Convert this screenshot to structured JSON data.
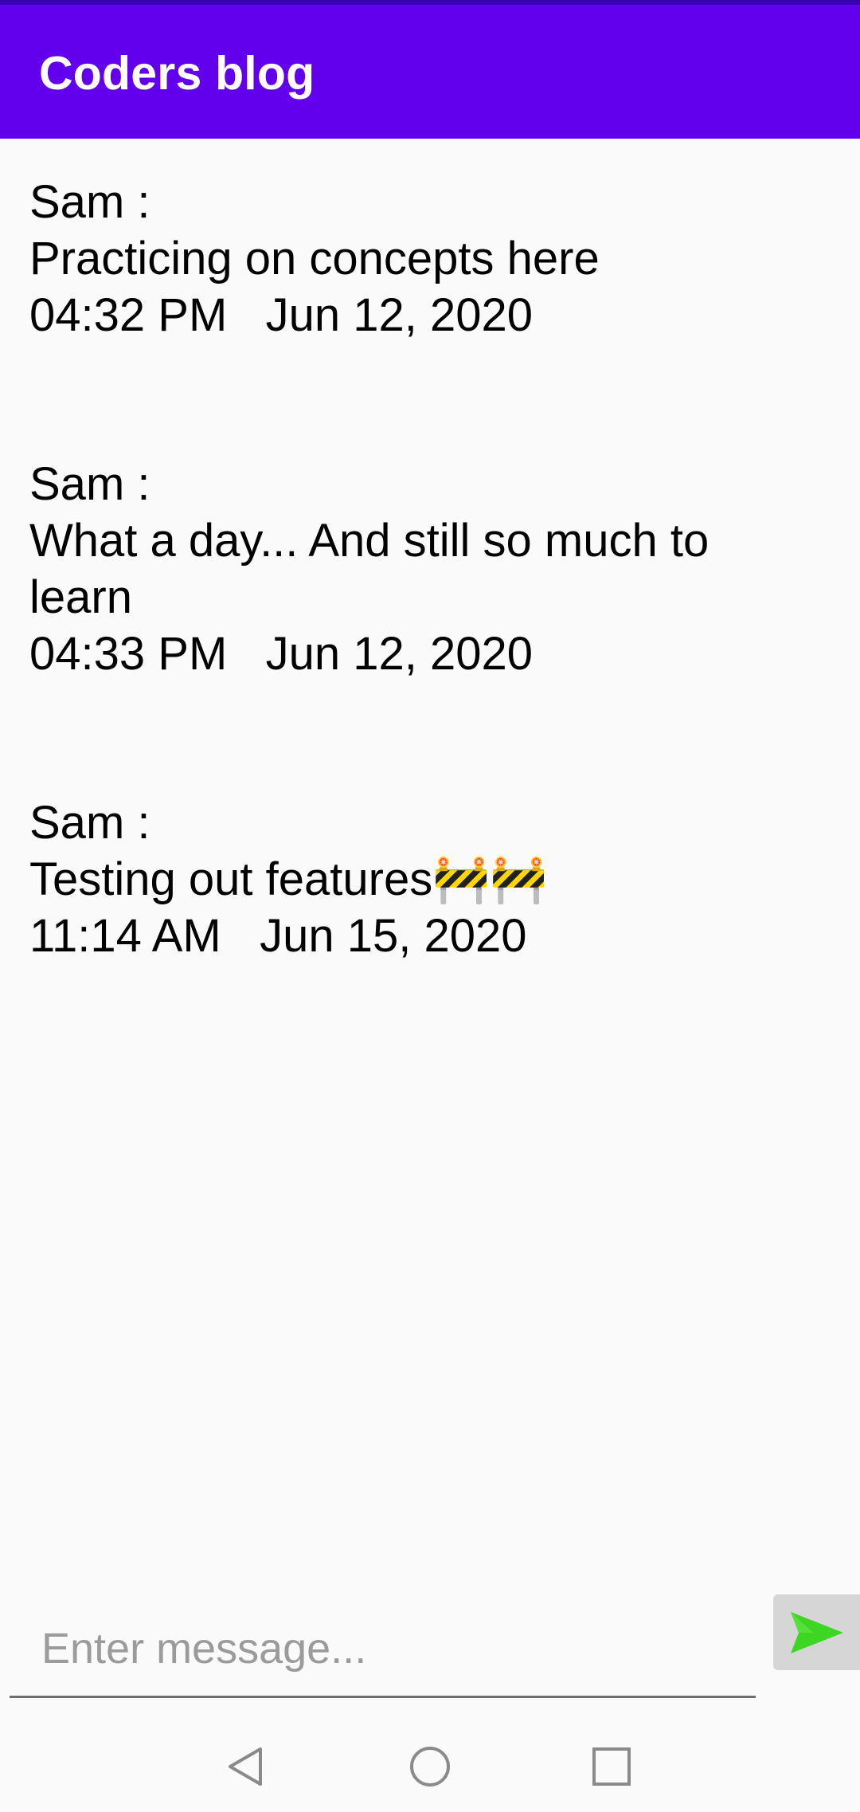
{
  "app_bar": {
    "title": "Coders blog",
    "color": "#6200ee"
  },
  "messages": [
    {
      "sender": "Sam :",
      "text": "Practicing on concepts here",
      "timestamp": "04:32 PM   Jun 12, 2020"
    },
    {
      "sender": "Sam :",
      "text": "What a day... And still so much to learn",
      "timestamp": "04:33 PM   Jun 12, 2020"
    },
    {
      "sender": "Sam :",
      "text": "Testing out features🚧🚧",
      "timestamp": "11:14 AM   Jun 15, 2020"
    }
  ],
  "composer": {
    "placeholder": "Enter message...",
    "value": "",
    "send_icon": "send-icon",
    "send_color": "#3dd622"
  },
  "nav": {
    "back_icon": "back-triangle-icon",
    "home_icon": "home-circle-icon",
    "recents_icon": "recents-square-icon"
  }
}
